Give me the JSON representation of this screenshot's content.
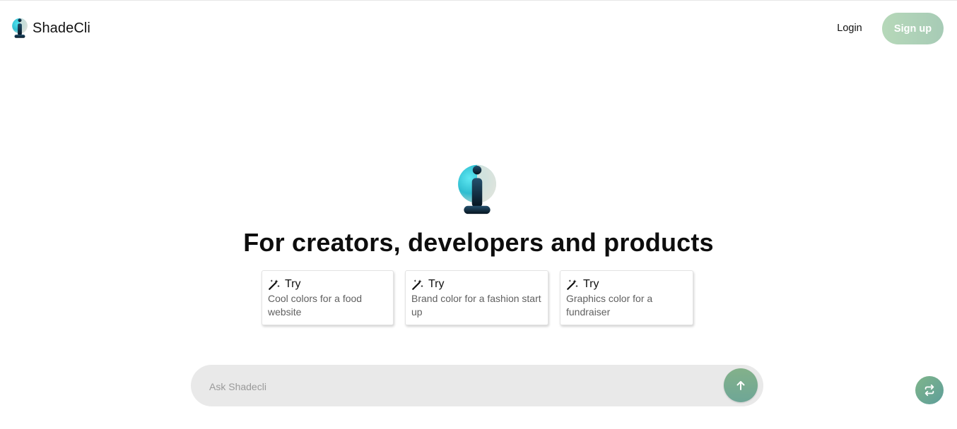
{
  "header": {
    "brand_name": "ShadeCli",
    "login_label": "Login",
    "signup_label": "Sign up"
  },
  "hero": {
    "headline": "For creators, developers and products"
  },
  "suggestions": [
    {
      "label": "Try",
      "text": "Cool colors for a food website",
      "icon": "magic-wand-icon"
    },
    {
      "label": "Try",
      "text": "Brand color for a fashion start up",
      "icon": "magic-wand-icon"
    },
    {
      "label": "Try",
      "text": "Graphics color for a fundraiser",
      "icon": "magic-wand-icon"
    }
  ],
  "chat": {
    "placeholder": "Ask Shadecli",
    "value": "",
    "send_icon": "arrow-up-icon"
  },
  "fab": {
    "icon": "swap-icon"
  },
  "colors": {
    "accent_green": "#7fb38b",
    "signup_bg": "#b1d4b7",
    "input_bg": "#e9e9e9"
  }
}
